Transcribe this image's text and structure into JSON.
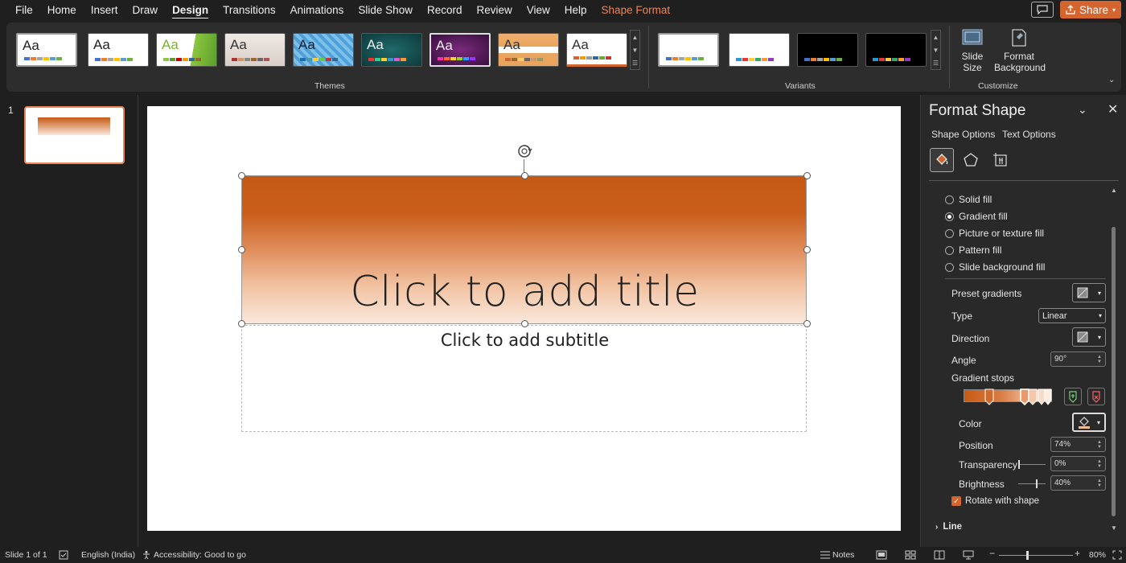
{
  "menu": {
    "items": [
      "File",
      "Home",
      "Insert",
      "Draw",
      "Design",
      "Transitions",
      "Animations",
      "Slide Show",
      "Record",
      "Review",
      "View",
      "Help",
      "Shape Format"
    ],
    "active": "Design",
    "share_label": "Share"
  },
  "ribbon": {
    "themes_label": "Themes",
    "variants_label": "Variants",
    "customize_label": "Customize",
    "slide_size_label": "Slide Size",
    "format_background_label": "Format Background",
    "theme_text": "Aa"
  },
  "slides": {
    "number": "1"
  },
  "slide": {
    "title": "Click to add title",
    "subtitle": "Click to add subtitle",
    "gradient_colors": [
      "#c65a14",
      "#e08d5c",
      "#fae8dc"
    ]
  },
  "pane": {
    "title": "Format Shape",
    "tabs": [
      "Shape Options",
      "Text Options"
    ],
    "fill_options": [
      {
        "label": "Solid fill",
        "selected": false
      },
      {
        "label": "Gradient fill",
        "selected": true
      },
      {
        "label": "Picture or texture fill",
        "selected": false
      },
      {
        "label": "Pattern fill",
        "selected": false
      },
      {
        "label": "Slide background fill",
        "selected": false
      }
    ],
    "preset_gradients_label": "Preset gradients",
    "type_label": "Type",
    "type_value": "Linear",
    "direction_label": "Direction",
    "angle_label": "Angle",
    "angle_value": "90°",
    "gradient_stops_label": "Gradient stops",
    "color_label": "Color",
    "position_label": "Position",
    "position_value": "74%",
    "transparency_label": "Transparency",
    "transparency_value": "0%",
    "brightness_label": "Brightness",
    "brightness_value": "40%",
    "rotate_with_shape_label": "Rotate with shape",
    "rotate_with_shape_checked": true,
    "line_label": "Line"
  },
  "status": {
    "slide_info": "Slide 1 of 1",
    "language": "English (India)",
    "accessibility": "Accessibility: Good to go",
    "notes_label": "Notes",
    "zoom": "80%"
  },
  "colors": {
    "accent": "#d4652e",
    "selection_border": "#e8865a"
  }
}
